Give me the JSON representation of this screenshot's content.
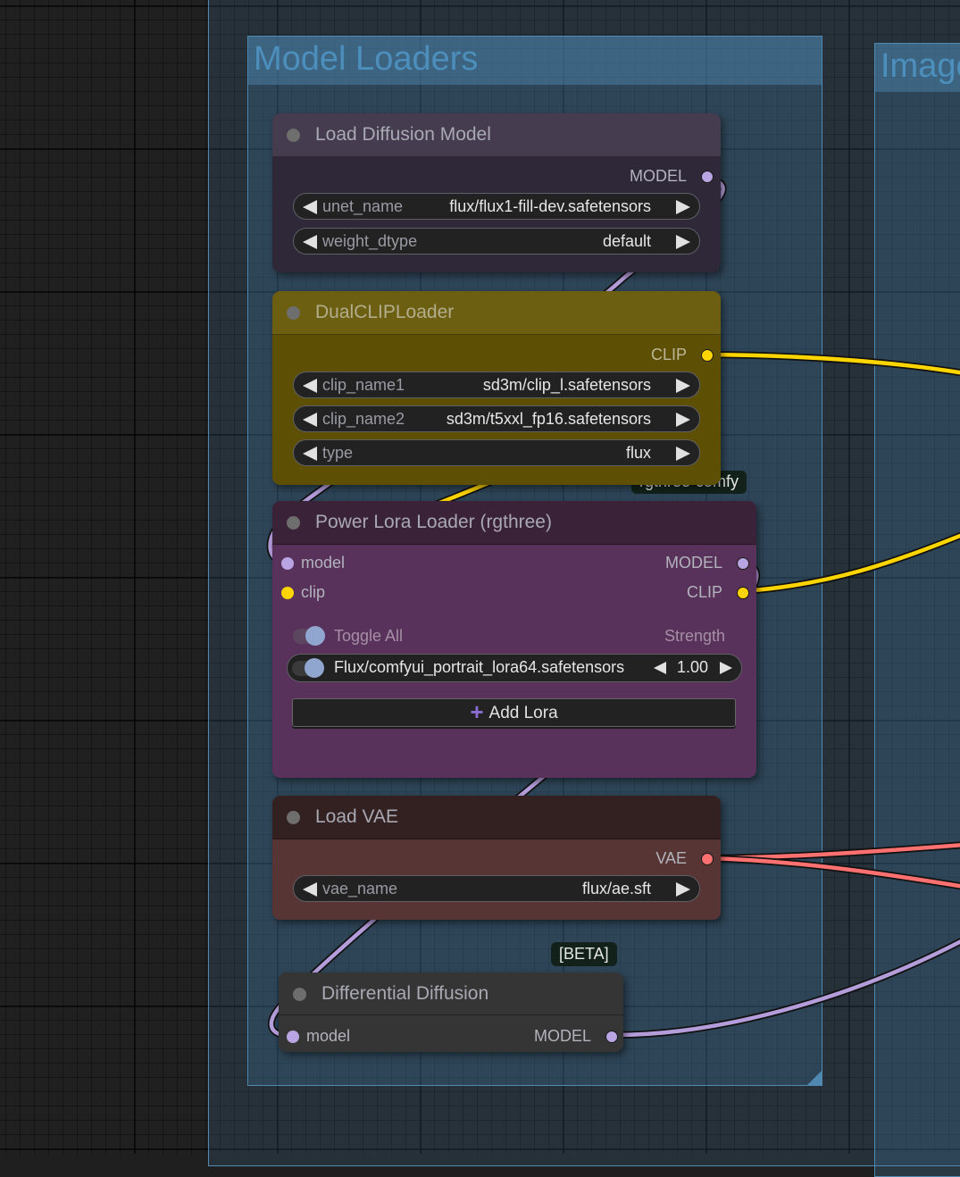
{
  "canvas": {
    "groups": [
      {
        "title": "Model Loaders"
      },
      {
        "title": "Image"
      }
    ]
  },
  "colors": {
    "model_link": "#b39ddb",
    "clip_link": "#ffd500",
    "vae_link": "#ff6e6e",
    "group_border": "#4f89b2",
    "group_title": "#4d8fbc"
  },
  "nodes": {
    "load_diffusion_model": {
      "title": "Load Diffusion Model",
      "outputs": [
        {
          "label": "MODEL",
          "type": "model"
        }
      ],
      "widgets": [
        {
          "label": "unet_name",
          "value": "flux/flux1-fill-dev.safetensors"
        },
        {
          "label": "weight_dtype",
          "value": "default"
        }
      ]
    },
    "dual_clip_loader": {
      "title": "DualCLIPLoader",
      "outputs": [
        {
          "label": "CLIP",
          "type": "clip"
        }
      ],
      "widgets": [
        {
          "label": "clip_name1",
          "value": "sd3m/clip_l.safetensors"
        },
        {
          "label": "clip_name2",
          "value": "sd3m/t5xxl_fp16.safetensors"
        },
        {
          "label": "type",
          "value": "flux"
        }
      ]
    },
    "power_lora_loader": {
      "title": "Power Lora Loader (rgthree)",
      "badge": "rgthree-comfy",
      "inputs": [
        {
          "label": "model",
          "type": "model"
        },
        {
          "label": "clip",
          "type": "clip"
        }
      ],
      "outputs": [
        {
          "label": "MODEL",
          "type": "model"
        },
        {
          "label": "CLIP",
          "type": "clip"
        }
      ],
      "toggle_all_label": "Toggle All",
      "strength_header": "Strength",
      "loras": [
        {
          "name": "Flux/comfyui_portrait_lora64.safetensors",
          "strength": "1.00",
          "enabled": true
        }
      ],
      "add_lora_label": "Add Lora"
    },
    "load_vae": {
      "title": "Load VAE",
      "outputs": [
        {
          "label": "VAE",
          "type": "vae"
        }
      ],
      "widgets": [
        {
          "label": "vae_name",
          "value": "flux/ae.sft"
        }
      ]
    },
    "differential_diffusion": {
      "title": "Differential Diffusion",
      "badge": "[BETA]",
      "inputs": [
        {
          "label": "model",
          "type": "model"
        }
      ],
      "outputs": [
        {
          "label": "MODEL",
          "type": "model"
        }
      ]
    }
  }
}
